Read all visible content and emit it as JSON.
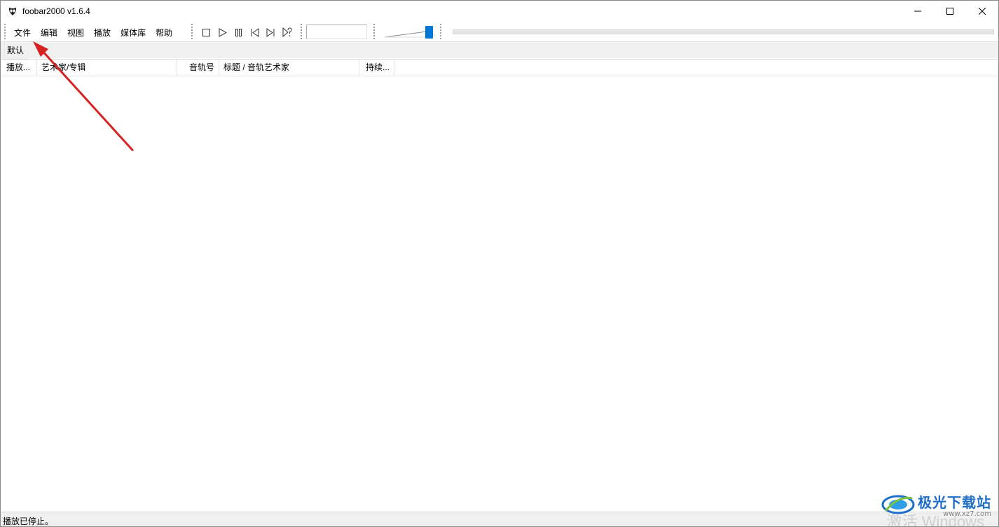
{
  "window": {
    "title": "foobar2000 v1.6.4"
  },
  "menu": {
    "items": [
      "文件",
      "编辑",
      "视图",
      "播放",
      "媒体库",
      "帮助"
    ]
  },
  "toolbar": {
    "buttons": [
      "stop-icon",
      "play-icon",
      "pause-icon",
      "previous-icon",
      "next-icon",
      "random-icon"
    ],
    "volume_level": 1.0,
    "seek_position": 0
  },
  "playlist_tabs": [
    "默认"
  ],
  "columns": [
    "播放...",
    "艺术家/专辑",
    "音轨号",
    "标题 / 音轨艺术家",
    "持续..."
  ],
  "status": {
    "text": "播放已停止。"
  },
  "colors": {
    "accent": "#0078d7",
    "arrow": "#d62222"
  },
  "watermark": {
    "brand": "极光下载站",
    "url": "www.xz7.com",
    "activate": "激活 Windows"
  }
}
